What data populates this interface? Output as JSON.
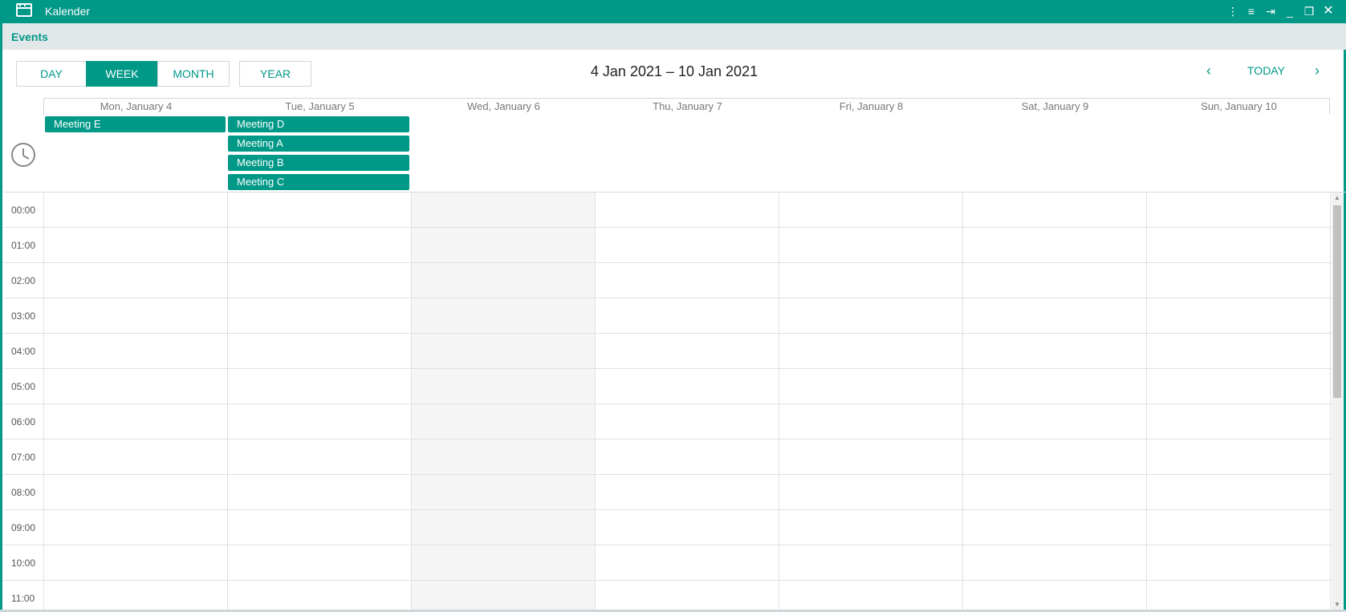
{
  "window": {
    "title": "Kalender",
    "controls": [
      "more-vert-icon",
      "menu-icon",
      "pin-icon",
      "minimize-icon",
      "restore-icon",
      "close-icon"
    ]
  },
  "panel": {
    "title": "Events"
  },
  "toolbar": {
    "views": [
      "DAY",
      "WEEK",
      "MONTH",
      "YEAR"
    ],
    "active_view": "WEEK",
    "date_range": "4 Jan 2021 – 10 Jan 2021",
    "today_label": "TODAY"
  },
  "days": [
    "Mon, January 4",
    "Tue, January 5",
    "Wed, January 6",
    "Thu, January 7",
    "Fri, January 8",
    "Sat, January 9",
    "Sun, January 10"
  ],
  "all_day_events": [
    {
      "label": "Meeting E",
      "day_index": 0,
      "slot": 0
    },
    {
      "label": "Meeting D",
      "day_index": 1,
      "slot": 0
    },
    {
      "label": "Meeting A",
      "day_index": 1,
      "slot": 1
    },
    {
      "label": "Meeting B",
      "day_index": 1,
      "slot": 2
    },
    {
      "label": "Meeting C",
      "day_index": 1,
      "slot": 3
    }
  ],
  "hours": [
    "00:00",
    "01:00",
    "02:00",
    "03:00",
    "04:00",
    "05:00",
    "06:00",
    "07:00",
    "08:00",
    "09:00",
    "10:00",
    "11:00"
  ],
  "colors": {
    "accent": "#009887",
    "panel_bg": "#e2e7ea",
    "shade": "#f5f5f5"
  }
}
